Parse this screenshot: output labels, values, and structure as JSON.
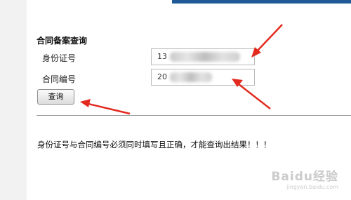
{
  "form": {
    "title": "合同备案查询",
    "id_label": "身份证号",
    "id_value": "13",
    "contract_label": "合同编号",
    "contract_value": "20",
    "query_button": "查询"
  },
  "notice": "身份证号与合同编号必须同时填写且正确，才能查询出结果！！！",
  "watermark": {
    "main": "Baidu经验",
    "sub": "jingyan.baidu.com"
  },
  "colors": {
    "arrow": "#e32a1f",
    "topbar": "#1f5a96"
  }
}
